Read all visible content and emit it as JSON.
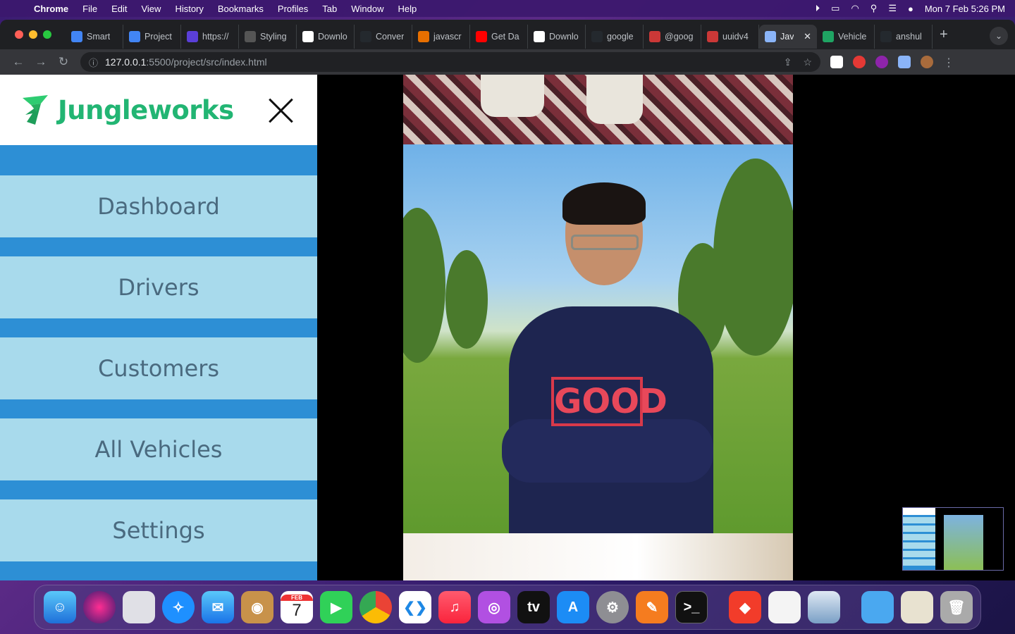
{
  "menubar": {
    "app": "Chrome",
    "items": [
      "File",
      "Edit",
      "View",
      "History",
      "Bookmarks",
      "Profiles",
      "Tab",
      "Window",
      "Help"
    ],
    "clock": "Mon 7 Feb  5:26 PM"
  },
  "tabs": [
    {
      "title": "Smart",
      "icon": "docs-icon",
      "color": "#4285f4"
    },
    {
      "title": "Project",
      "icon": "docs-icon",
      "color": "#4285f4"
    },
    {
      "title": "https://",
      "icon": "globe-icon",
      "color": "#5a3fd8"
    },
    {
      "title": "Styling",
      "icon": "openai-icon",
      "color": "#555555"
    },
    {
      "title": "Downlo",
      "icon": "google-icon",
      "color": "#ffffff"
    },
    {
      "title": "Conver",
      "icon": "github-icon",
      "color": "#24292e"
    },
    {
      "title": "javascr",
      "icon": "java-icon",
      "color": "#e76f00"
    },
    {
      "title": "Get Da",
      "icon": "youtube-icon",
      "color": "#ff0000"
    },
    {
      "title": "Downlo",
      "icon": "google-icon",
      "color": "#ffffff"
    },
    {
      "title": "google",
      "icon": "github-icon",
      "color": "#24292e"
    },
    {
      "title": "@goog",
      "icon": "npm-icon",
      "color": "#cb3837"
    },
    {
      "title": "uuidv4",
      "icon": "npm-icon",
      "color": "#cb3837"
    },
    {
      "title": "Jav",
      "icon": "globe-icon",
      "color": "#8ab4f8",
      "active": true
    },
    {
      "title": "Vehicle",
      "icon": "sheet-icon",
      "color": "#1fa463"
    },
    {
      "title": "anshul",
      "icon": "github-icon",
      "color": "#24292e"
    }
  ],
  "address": {
    "host": "127.0.0.1",
    "path": ":5500/project/src/index.html"
  },
  "brand": {
    "name": "Jungleworks",
    "color": "#22b573"
  },
  "nav": [
    {
      "label": "Dashboard"
    },
    {
      "label": "Drivers"
    },
    {
      "label": "Customers"
    },
    {
      "label": "All Vehicles"
    },
    {
      "label": "Settings"
    }
  ],
  "photo": {
    "shirt_text": "GOOD"
  },
  "calendar": {
    "month": "FEB",
    "day": "7"
  }
}
